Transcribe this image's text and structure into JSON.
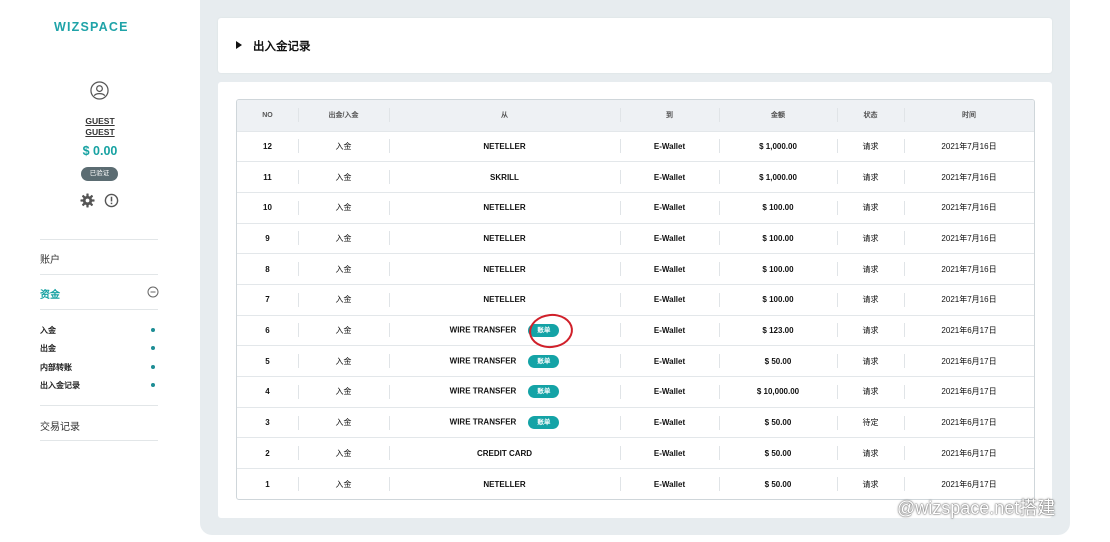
{
  "brand": "WIZSPACE",
  "user": {
    "name1": "GUEST",
    "name2": "GUEST",
    "balance": "$ 0.00",
    "verified": "已验证"
  },
  "nav": {
    "account": "账户",
    "funds": "资金",
    "sub_items": [
      "入金",
      "出金",
      "内部转账",
      "出入金记录"
    ],
    "trade_records": "交易记录"
  },
  "page_title": "出入金记录",
  "table": {
    "headers": [
      "NO",
      "出金/入金",
      "从",
      "到",
      "金额",
      "状态",
      "时间"
    ],
    "rows": [
      {
        "no": "12",
        "type": "入金",
        "from": "NETELLER",
        "bill": "",
        "to": "E-Wallet",
        "amount": "$ 1,000.00",
        "status": "请求",
        "time": "2021年7月16日"
      },
      {
        "no": "11",
        "type": "入金",
        "from": "SKRILL",
        "bill": "",
        "to": "E-Wallet",
        "amount": "$ 1,000.00",
        "status": "请求",
        "time": "2021年7月16日"
      },
      {
        "no": "10",
        "type": "入金",
        "from": "NETELLER",
        "bill": "",
        "to": "E-Wallet",
        "amount": "$ 100.00",
        "status": "请求",
        "time": "2021年7月16日"
      },
      {
        "no": "9",
        "type": "入金",
        "from": "NETELLER",
        "bill": "",
        "to": "E-Wallet",
        "amount": "$ 100.00",
        "status": "请求",
        "time": "2021年7月16日"
      },
      {
        "no": "8",
        "type": "入金",
        "from": "NETELLER",
        "bill": "",
        "to": "E-Wallet",
        "amount": "$ 100.00",
        "status": "请求",
        "time": "2021年7月16日"
      },
      {
        "no": "7",
        "type": "入金",
        "from": "NETELLER",
        "bill": "",
        "to": "E-Wallet",
        "amount": "$ 100.00",
        "status": "请求",
        "time": "2021年7月16日"
      },
      {
        "no": "6",
        "type": "入金",
        "from": "WIRE TRANSFER",
        "bill": "账单",
        "to": "E-Wallet",
        "amount": "$ 123.00",
        "status": "请求",
        "time": "2021年6月17日"
      },
      {
        "no": "5",
        "type": "入金",
        "from": "WIRE TRANSFER",
        "bill": "账单",
        "to": "E-Wallet",
        "amount": "$ 50.00",
        "status": "请求",
        "time": "2021年6月17日"
      },
      {
        "no": "4",
        "type": "入金",
        "from": "WIRE TRANSFER",
        "bill": "账单",
        "to": "E-Wallet",
        "amount": "$ 10,000.00",
        "status": "请求",
        "time": "2021年6月17日"
      },
      {
        "no": "3",
        "type": "入金",
        "from": "WIRE TRANSFER",
        "bill": "账单",
        "to": "E-Wallet",
        "amount": "$ 50.00",
        "status": "待定",
        "time": "2021年6月17日"
      },
      {
        "no": "2",
        "type": "入金",
        "from": "CREDIT CARD",
        "bill": "",
        "to": "E-Wallet",
        "amount": "$ 50.00",
        "status": "请求",
        "time": "2021年6月17日"
      },
      {
        "no": "1",
        "type": "入金",
        "from": "NETELLER",
        "bill": "",
        "to": "E-Wallet",
        "amount": "$ 50.00",
        "status": "请求",
        "time": "2021年6月17日"
      }
    ]
  },
  "watermark": "@wizspace.net搭建",
  "colors": {
    "accent": "#17a2a2",
    "badge": "#14a3a6",
    "annotation": "#d0202a"
  }
}
